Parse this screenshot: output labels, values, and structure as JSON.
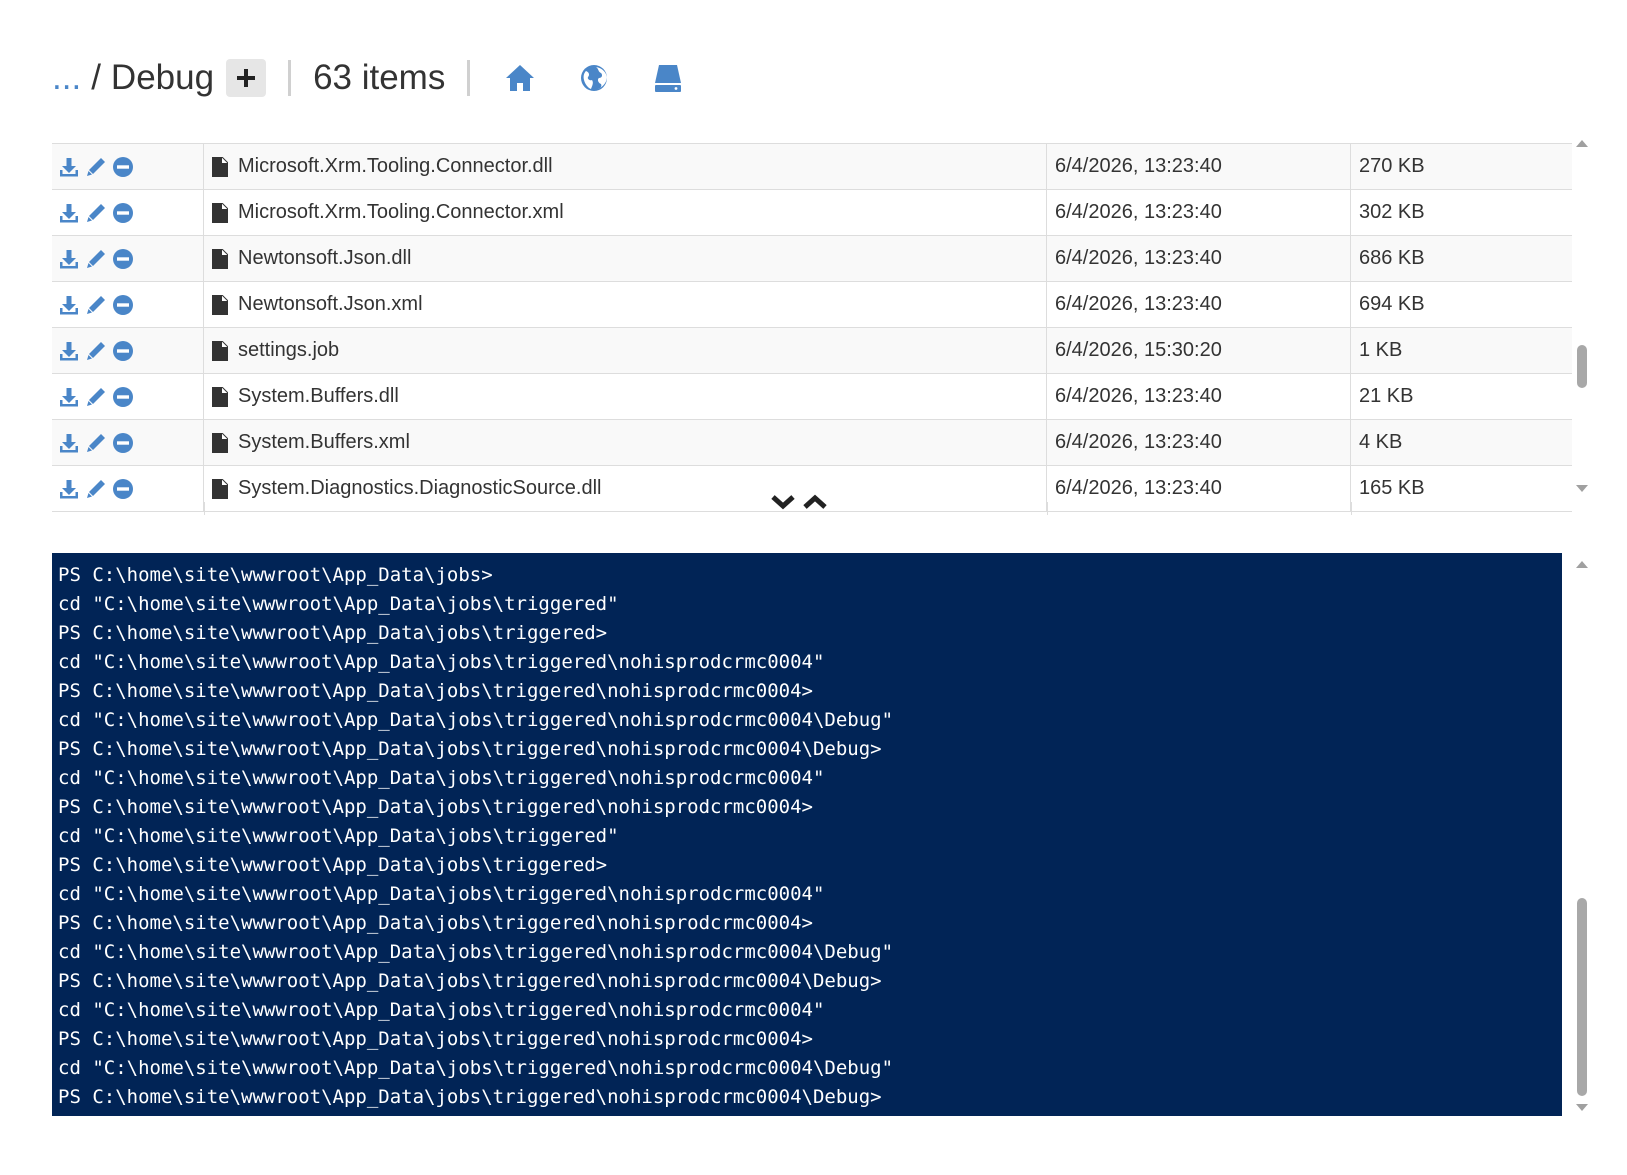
{
  "breadcrumb": {
    "ellipsis": "...",
    "separator": "/",
    "current": "Debug"
  },
  "items_count": "63 items",
  "icons": {
    "add": "plus-icon",
    "home": "home-icon",
    "globe": "globe-icon",
    "drive": "drive-icon",
    "download": "download-icon",
    "edit": "pencil-icon",
    "delete": "minus-circle-icon",
    "file": "file-icon"
  },
  "colors": {
    "accent": "#4a86c8",
    "console_bg": "#012456",
    "console_text": "#ffffff"
  },
  "files": [
    {
      "name": "Microsoft.Xrm.Tooling.Connector.dll",
      "modified": "6/4/2026, 13:23:40",
      "size": "270 KB"
    },
    {
      "name": "Microsoft.Xrm.Tooling.Connector.xml",
      "modified": "6/4/2026, 13:23:40",
      "size": "302 KB"
    },
    {
      "name": "Newtonsoft.Json.dll",
      "modified": "6/4/2026, 13:23:40",
      "size": "686 KB"
    },
    {
      "name": "Newtonsoft.Json.xml",
      "modified": "6/4/2026, 13:23:40",
      "size": "694 KB"
    },
    {
      "name": "settings.job",
      "modified": "6/4/2026, 15:30:20",
      "size": "1 KB"
    },
    {
      "name": "System.Buffers.dll",
      "modified": "6/4/2026, 13:23:40",
      "size": "21 KB"
    },
    {
      "name": "System.Buffers.xml",
      "modified": "6/4/2026, 13:23:40",
      "size": "4 KB"
    },
    {
      "name": "System.Diagnostics.DiagnosticSource.dll",
      "modified": "6/4/2026, 13:23:40",
      "size": "165 KB"
    }
  ],
  "console_lines": [
    "PS C:\\home\\site\\wwwroot\\App_Data\\jobs>",
    "cd \"C:\\home\\site\\wwwroot\\App_Data\\jobs\\triggered\"",
    "PS C:\\home\\site\\wwwroot\\App_Data\\jobs\\triggered>",
    "cd \"C:\\home\\site\\wwwroot\\App_Data\\jobs\\triggered\\nohisprodcrmc0004\"",
    "PS C:\\home\\site\\wwwroot\\App_Data\\jobs\\triggered\\nohisprodcrmc0004>",
    "cd \"C:\\home\\site\\wwwroot\\App_Data\\jobs\\triggered\\nohisprodcrmc0004\\Debug\"",
    "PS C:\\home\\site\\wwwroot\\App_Data\\jobs\\triggered\\nohisprodcrmc0004\\Debug>",
    "cd \"C:\\home\\site\\wwwroot\\App_Data\\jobs\\triggered\\nohisprodcrmc0004\"",
    "PS C:\\home\\site\\wwwroot\\App_Data\\jobs\\triggered\\nohisprodcrmc0004>",
    "cd \"C:\\home\\site\\wwwroot\\App_Data\\jobs\\triggered\"",
    "PS C:\\home\\site\\wwwroot\\App_Data\\jobs\\triggered>",
    "cd \"C:\\home\\site\\wwwroot\\App_Data\\jobs\\triggered\\nohisprodcrmc0004\"",
    "PS C:\\home\\site\\wwwroot\\App_Data\\jobs\\triggered\\nohisprodcrmc0004>",
    "cd \"C:\\home\\site\\wwwroot\\App_Data\\jobs\\triggered\\nohisprodcrmc0004\\Debug\"",
    "PS C:\\home\\site\\wwwroot\\App_Data\\jobs\\triggered\\nohisprodcrmc0004\\Debug>",
    "cd \"C:\\home\\site\\wwwroot\\App_Data\\jobs\\triggered\\nohisprodcrmc0004\"",
    "PS C:\\home\\site\\wwwroot\\App_Data\\jobs\\triggered\\nohisprodcrmc0004>",
    "cd \"C:\\home\\site\\wwwroot\\App_Data\\jobs\\triggered\\nohisprodcrmc0004\\Debug\"",
    "PS C:\\home\\site\\wwwroot\\App_Data\\jobs\\triggered\\nohisprodcrmc0004\\Debug>"
  ]
}
